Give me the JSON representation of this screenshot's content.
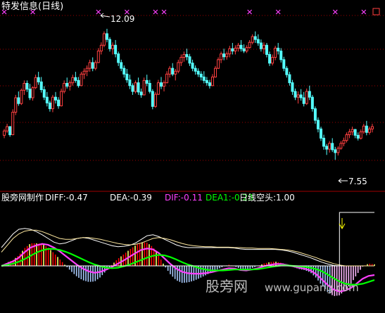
{
  "header": {
    "title": "特发信息(日线)",
    "high_label": "12.09",
    "low_label": "7.55"
  },
  "indicator_bar": {
    "source": "股旁网制作",
    "diff": "DIFF:-0.47",
    "dea": "DEA:-0.39",
    "dif": "DIF:-0.11",
    "dea1": "DEA1:-0.23",
    "signal": "日线空头:1.00"
  },
  "watermark": {
    "cn": "股旁网",
    "en": "www.gupang.com"
  },
  "colors": {
    "up": "#ff4040",
    "down": "#54ffff",
    "text": "#ffffff",
    "dif": "#ff40ff",
    "dea1": "#00ff00",
    "signal": "#ffffff",
    "marker": "#ff40ff",
    "grid": "#a00000",
    "hist_pos": "#ff0000",
    "hist_pos2": "#ffff66",
    "hist_neg": "#aaccff",
    "hist_neg2": "#ffbbff",
    "watermark": "#bbbbbb",
    "arrow": "#ffff00"
  },
  "chart_data": [
    {
      "type": "candlestick",
      "title": "特发信息(日线)",
      "ylim": [
        6.8,
        12.6
      ],
      "annotations": [
        {
          "label": "12.09",
          "value": 12.09,
          "index": 36
        },
        {
          "label": "7.55",
          "value": 7.55,
          "index": 119
        }
      ],
      "grid": true,
      "candles": [
        [
          8.4,
          8.62,
          8.3,
          8.55
        ],
        [
          8.55,
          8.8,
          8.48,
          8.7
        ],
        [
          8.7,
          8.72,
          8.35,
          8.42
        ],
        [
          8.42,
          9.3,
          8.4,
          9.2
        ],
        [
          9.2,
          9.8,
          9.1,
          9.7
        ],
        [
          9.7,
          9.92,
          9.42,
          9.5
        ],
        [
          9.5,
          10.02,
          9.45,
          9.96
        ],
        [
          9.96,
          10.3,
          9.8,
          10.2
        ],
        [
          10.2,
          10.3,
          9.9,
          10.0
        ],
        [
          10.0,
          10.18,
          9.62,
          9.7
        ],
        [
          9.7,
          10.1,
          9.6,
          10.05
        ],
        [
          10.05,
          10.5,
          10.0,
          10.4
        ],
        [
          10.4,
          10.6,
          10.15,
          10.25
        ],
        [
          10.25,
          10.42,
          9.88,
          9.98
        ],
        [
          9.98,
          10.1,
          9.62,
          9.72
        ],
        [
          9.72,
          9.9,
          9.4,
          9.52
        ],
        [
          9.52,
          9.6,
          9.22,
          9.32
        ],
        [
          9.32,
          9.8,
          9.2,
          9.72
        ],
        [
          9.72,
          9.9,
          9.5,
          9.62
        ],
        [
          9.62,
          9.72,
          9.32,
          9.42
        ],
        [
          9.42,
          10.02,
          9.4,
          9.92
        ],
        [
          9.92,
          10.3,
          9.85,
          10.2
        ],
        [
          10.2,
          10.4,
          10.02,
          10.1
        ],
        [
          10.1,
          10.3,
          9.95,
          10.22
        ],
        [
          10.22,
          10.5,
          10.12,
          10.4
        ],
        [
          10.4,
          10.6,
          10.22,
          10.3
        ],
        [
          10.3,
          10.42,
          10.05,
          10.12
        ],
        [
          10.12,
          10.6,
          10.1,
          10.52
        ],
        [
          10.52,
          10.72,
          10.35,
          10.62
        ],
        [
          10.62,
          10.82,
          10.45,
          10.72
        ],
        [
          10.72,
          11.02,
          10.6,
          10.92
        ],
        [
          10.92,
          11.1,
          10.62,
          10.72
        ],
        [
          10.72,
          11.0,
          10.65,
          10.92
        ],
        [
          10.92,
          11.42,
          10.9,
          11.32
        ],
        [
          11.32,
          11.62,
          11.2,
          11.52
        ],
        [
          11.52,
          12.0,
          11.45,
          11.92
        ],
        [
          11.92,
          12.09,
          11.62,
          11.72
        ],
        [
          11.72,
          11.8,
          11.3,
          11.4
        ],
        [
          11.4,
          11.62,
          11.2,
          11.52
        ],
        [
          11.52,
          11.7,
          11.1,
          11.22
        ],
        [
          11.22,
          11.3,
          10.8,
          10.92
        ],
        [
          10.92,
          11.02,
          10.62,
          10.72
        ],
        [
          10.72,
          10.82,
          10.4,
          10.52
        ],
        [
          10.52,
          10.7,
          10.22,
          10.32
        ],
        [
          10.32,
          10.5,
          10.0,
          10.12
        ],
        [
          10.12,
          10.2,
          9.8,
          9.92
        ],
        [
          9.92,
          10.3,
          9.85,
          10.22
        ],
        [
          10.22,
          10.4,
          9.8,
          9.9
        ],
        [
          9.9,
          10.02,
          9.7,
          9.8
        ],
        [
          9.8,
          10.4,
          9.78,
          10.3
        ],
        [
          10.3,
          10.5,
          10.1,
          10.2
        ],
        [
          10.2,
          10.32,
          9.85,
          9.92
        ],
        [
          9.92,
          10.0,
          9.3,
          9.4
        ],
        [
          9.4,
          9.9,
          9.35,
          9.82
        ],
        [
          9.82,
          10.32,
          9.8,
          10.22
        ],
        [
          10.22,
          10.42,
          10.0,
          10.1
        ],
        [
          10.1,
          10.3,
          9.92,
          10.22
        ],
        [
          10.22,
          10.62,
          10.2,
          10.52
        ],
        [
          10.52,
          10.8,
          10.4,
          10.72
        ],
        [
          10.72,
          10.9,
          10.45,
          10.52
        ],
        [
          10.52,
          10.7,
          10.3,
          10.62
        ],
        [
          10.62,
          11.02,
          10.55,
          10.92
        ],
        [
          10.92,
          11.2,
          10.8,
          11.1
        ],
        [
          11.1,
          11.3,
          10.95,
          11.2
        ],
        [
          11.2,
          11.4,
          11.0,
          11.12
        ],
        [
          11.12,
          11.22,
          10.8,
          10.9
        ],
        [
          10.9,
          11.02,
          10.62,
          10.72
        ],
        [
          10.72,
          10.82,
          10.5,
          10.62
        ],
        [
          10.62,
          10.72,
          10.42,
          10.52
        ],
        [
          10.52,
          10.62,
          10.3,
          10.42
        ],
        [
          10.42,
          10.62,
          10.2,
          10.3
        ],
        [
          10.3,
          10.42,
          10.12,
          10.22
        ],
        [
          10.22,
          10.32,
          10.02,
          10.12
        ],
        [
          10.12,
          10.52,
          10.1,
          10.42
        ],
        [
          10.42,
          10.8,
          10.4,
          10.72
        ],
        [
          10.72,
          11.1,
          10.7,
          11.02
        ],
        [
          11.02,
          11.3,
          10.9,
          11.22
        ],
        [
          11.22,
          11.4,
          11.0,
          11.12
        ],
        [
          11.12,
          11.3,
          11.02,
          11.22
        ],
        [
          11.22,
          11.5,
          11.1,
          11.4
        ],
        [
          11.4,
          11.6,
          11.2,
          11.32
        ],
        [
          11.32,
          11.52,
          11.2,
          11.42
        ],
        [
          11.42,
          11.6,
          11.3,
          11.52
        ],
        [
          11.52,
          11.7,
          11.3,
          11.4
        ],
        [
          11.4,
          11.55,
          11.25,
          11.32
        ],
        [
          11.32,
          11.52,
          11.25,
          11.44
        ],
        [
          11.44,
          11.7,
          11.4,
          11.62
        ],
        [
          11.62,
          11.9,
          11.55,
          11.82
        ],
        [
          11.82,
          12.0,
          11.6,
          11.72
        ],
        [
          11.72,
          11.9,
          11.5,
          11.6
        ],
        [
          11.6,
          11.72,
          11.3,
          11.4
        ],
        [
          11.4,
          11.62,
          11.22,
          11.52
        ],
        [
          11.52,
          11.6,
          11.1,
          11.2
        ],
        [
          11.2,
          11.3,
          10.8,
          10.9
        ],
        [
          10.9,
          11.2,
          10.82,
          11.1
        ],
        [
          11.1,
          11.5,
          11.0,
          11.42
        ],
        [
          11.42,
          11.6,
          11.2,
          11.32
        ],
        [
          11.32,
          11.42,
          10.92,
          11.02
        ],
        [
          11.02,
          11.12,
          10.62,
          10.72
        ],
        [
          10.72,
          10.8,
          10.4,
          10.5
        ],
        [
          10.5,
          10.6,
          10.12,
          10.22
        ],
        [
          10.22,
          10.32,
          9.8,
          9.92
        ],
        [
          9.92,
          10.02,
          9.62,
          9.72
        ],
        [
          9.72,
          9.92,
          9.5,
          9.8
        ],
        [
          9.8,
          10.0,
          9.6,
          9.7
        ],
        [
          9.7,
          9.9,
          9.4,
          9.5
        ],
        [
          9.5,
          10.02,
          9.45,
          9.92
        ],
        [
          9.92,
          10.12,
          9.62,
          9.72
        ],
        [
          9.72,
          9.8,
          9.22,
          9.32
        ],
        [
          9.32,
          9.4,
          8.8,
          8.92
        ],
        [
          8.92,
          9.02,
          8.5,
          8.62
        ],
        [
          8.62,
          8.7,
          8.2,
          8.3
        ],
        [
          8.3,
          8.42,
          7.9,
          8.02
        ],
        [
          8.02,
          8.1,
          7.72,
          7.92
        ],
        [
          7.92,
          8.2,
          7.8,
          8.12
        ],
        [
          8.12,
          8.3,
          7.82,
          7.9
        ],
        [
          7.9,
          8.0,
          7.55,
          7.8
        ],
        [
          7.8,
          8.02,
          7.7,
          7.95
        ],
        [
          7.95,
          8.2,
          7.9,
          8.12
        ],
        [
          8.12,
          8.32,
          8.02,
          8.22
        ],
        [
          8.22,
          8.5,
          8.15,
          8.42
        ],
        [
          8.42,
          8.62,
          8.3,
          8.52
        ],
        [
          8.52,
          8.7,
          8.4,
          8.6
        ],
        [
          8.6,
          8.62,
          8.3,
          8.4
        ],
        [
          8.4,
          8.5,
          8.22,
          8.3
        ],
        [
          8.3,
          8.6,
          8.25,
          8.52
        ],
        [
          8.52,
          8.8,
          8.45,
          8.72
        ],
        [
          8.72,
          8.9,
          8.4,
          8.5
        ],
        [
          8.5,
          8.7,
          8.42,
          8.62
        ],
        [
          8.62,
          8.8,
          8.5,
          8.7
        ]
      ],
      "markers": [
        0,
        10,
        33,
        43,
        53,
        56,
        86,
        96,
        116,
        126
      ]
    },
    {
      "type": "line",
      "series": [
        {
          "name": "DIF",
          "values": [
            0.0,
            0.05,
            0.1,
            0.18,
            0.3,
            0.4,
            0.45,
            0.48,
            0.46,
            0.4,
            0.32,
            0.22,
            0.12,
            0.02,
            -0.06,
            -0.12,
            -0.15,
            -0.13,
            -0.08,
            -0.02,
            0.05,
            0.12,
            0.2,
            0.28,
            0.35,
            0.38,
            0.36,
            0.28,
            0.16,
            0.04,
            -0.06,
            -0.13,
            -0.16,
            -0.17,
            -0.17,
            -0.16,
            -0.14,
            -0.11,
            -0.08,
            -0.05,
            -0.06,
            -0.09,
            -0.1,
            -0.08,
            -0.05,
            -0.01,
            0.02,
            0.04,
            0.04,
            0.02,
            -0.01,
            -0.04,
            -0.06,
            -0.1,
            -0.18,
            -0.3,
            -0.42,
            -0.52,
            -0.56,
            -0.54,
            -0.48,
            -0.38,
            -0.28,
            -0.22,
            -0.2
          ]
        },
        {
          "name": "DEA1",
          "values": [
            0.0,
            0.02,
            0.05,
            0.09,
            0.15,
            0.22,
            0.29,
            0.34,
            0.37,
            0.37,
            0.35,
            0.31,
            0.26,
            0.2,
            0.14,
            0.08,
            0.03,
            -0.01,
            -0.04,
            -0.05,
            -0.04,
            -0.01,
            0.03,
            0.08,
            0.13,
            0.18,
            0.22,
            0.24,
            0.23,
            0.19,
            0.14,
            0.08,
            0.03,
            -0.01,
            -0.05,
            -0.08,
            -0.1,
            -0.1,
            -0.1,
            -0.09,
            -0.08,
            -0.08,
            -0.08,
            -0.08,
            -0.07,
            -0.05,
            -0.03,
            -0.01,
            0.01,
            0.01,
            0.0,
            -0.01,
            -0.02,
            -0.04,
            -0.07,
            -0.12,
            -0.19,
            -0.27,
            -0.34,
            -0.39,
            -0.41,
            -0.41,
            -0.39,
            -0.35,
            -0.31
          ]
        },
        {
          "name": "DIFF",
          "values": [
            0.4,
            0.55,
            0.7,
            0.8,
            0.82,
            0.8,
            0.75,
            0.68,
            0.6,
            0.52,
            0.48,
            0.5,
            0.55,
            0.6,
            0.62,
            0.6,
            0.56,
            0.52,
            0.48,
            0.44,
            0.42,
            0.43,
            0.45,
            0.5,
            0.58,
            0.66,
            0.68,
            0.64,
            0.58,
            0.52,
            0.46,
            0.42,
            0.4,
            0.4,
            0.4,
            0.4,
            0.4,
            0.4,
            0.4,
            0.4,
            0.39,
            0.37,
            0.36,
            0.36,
            0.36,
            0.36,
            0.36,
            0.36,
            0.35,
            0.33,
            0.3,
            0.26,
            0.22,
            0.18,
            0.13,
            0.08,
            0.04,
            0.01,
            0.0,
            0.0,
            0.0,
            0.0,
            0.0,
            0.0,
            0.0
          ]
        },
        {
          "name": "DEA",
          "values": [
            0.3,
            0.45,
            0.6,
            0.7,
            0.76,
            0.78,
            0.78,
            0.75,
            0.7,
            0.65,
            0.6,
            0.58,
            0.58,
            0.6,
            0.62,
            0.62,
            0.6,
            0.58,
            0.55,
            0.52,
            0.49,
            0.47,
            0.46,
            0.47,
            0.5,
            0.55,
            0.6,
            0.62,
            0.6,
            0.57,
            0.53,
            0.49,
            0.46,
            0.44,
            0.43,
            0.42,
            0.42,
            0.41,
            0.41,
            0.41,
            0.4,
            0.4,
            0.39,
            0.39,
            0.38,
            0.38,
            0.38,
            0.37,
            0.36,
            0.35,
            0.33,
            0.3,
            0.26,
            0.22,
            0.18,
            0.13,
            0.09,
            0.05,
            0.02,
            0.0,
            0.0,
            0.0,
            0.0,
            0.0,
            0.0
          ]
        },
        {
          "name": "日线空头",
          "values": [
            0,
            0,
            0,
            0,
            0,
            0,
            0,
            0,
            0,
            0,
            0,
            0,
            0,
            0,
            0,
            0,
            0,
            0,
            0,
            0,
            0,
            0,
            0,
            0,
            0,
            0,
            0,
            0,
            0,
            0,
            0,
            0,
            0,
            0,
            0,
            0,
            0,
            0,
            0,
            0,
            0,
            0,
            0,
            0,
            0,
            0,
            0,
            0,
            0,
            0,
            0,
            0,
            0,
            0,
            0,
            0,
            0,
            0,
            1,
            1,
            1,
            1,
            1,
            1,
            1
          ]
        }
      ]
    }
  ]
}
